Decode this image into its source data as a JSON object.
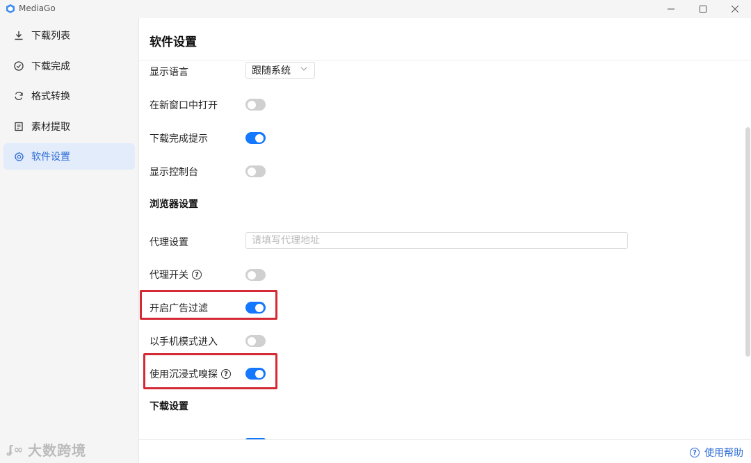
{
  "window": {
    "app_title": "MediaGo",
    "controls": {
      "minimize": "—",
      "maximize": "☐",
      "close": "✕"
    }
  },
  "sidebar": {
    "items": [
      {
        "label": "下载列表",
        "icon": "download-icon"
      },
      {
        "label": "下载完成",
        "icon": "check-circle-icon"
      },
      {
        "label": "格式转换",
        "icon": "refresh-icon"
      },
      {
        "label": "素材提取",
        "icon": "document-icon"
      },
      {
        "label": "软件设置",
        "icon": "gear-icon",
        "active": true
      }
    ],
    "watermark": "大数跨境"
  },
  "main": {
    "title": "软件设置",
    "settings": {
      "language": {
        "label": "显示语言",
        "value": "跟随系统"
      },
      "open_new_window": {
        "label": "在新窗口中打开",
        "enabled": false
      },
      "download_complete_notice": {
        "label": "下载完成提示",
        "enabled": true
      },
      "show_console": {
        "label": "显示控制台",
        "enabled": false
      }
    },
    "browser_section": {
      "title": "浏览器设置",
      "proxy": {
        "label": "代理设置",
        "placeholder": "请填写代理地址",
        "value": ""
      },
      "proxy_switch": {
        "label": "代理开关",
        "enabled": false
      },
      "ad_filter": {
        "label": "开启广告过滤",
        "enabled": true
      },
      "mobile_mode": {
        "label": "以手机模式进入",
        "enabled": false
      },
      "immersive_sniff": {
        "label": "使用沉浸式嗅探",
        "enabled": true
      }
    },
    "download_section": {
      "title": "下载设置"
    },
    "footer": {
      "help_label": "使用帮助"
    }
  },
  "colors": {
    "accent": "#1677ff",
    "sidebar_active_bg": "#e2ecfb",
    "highlight_box": "#d42a35"
  }
}
